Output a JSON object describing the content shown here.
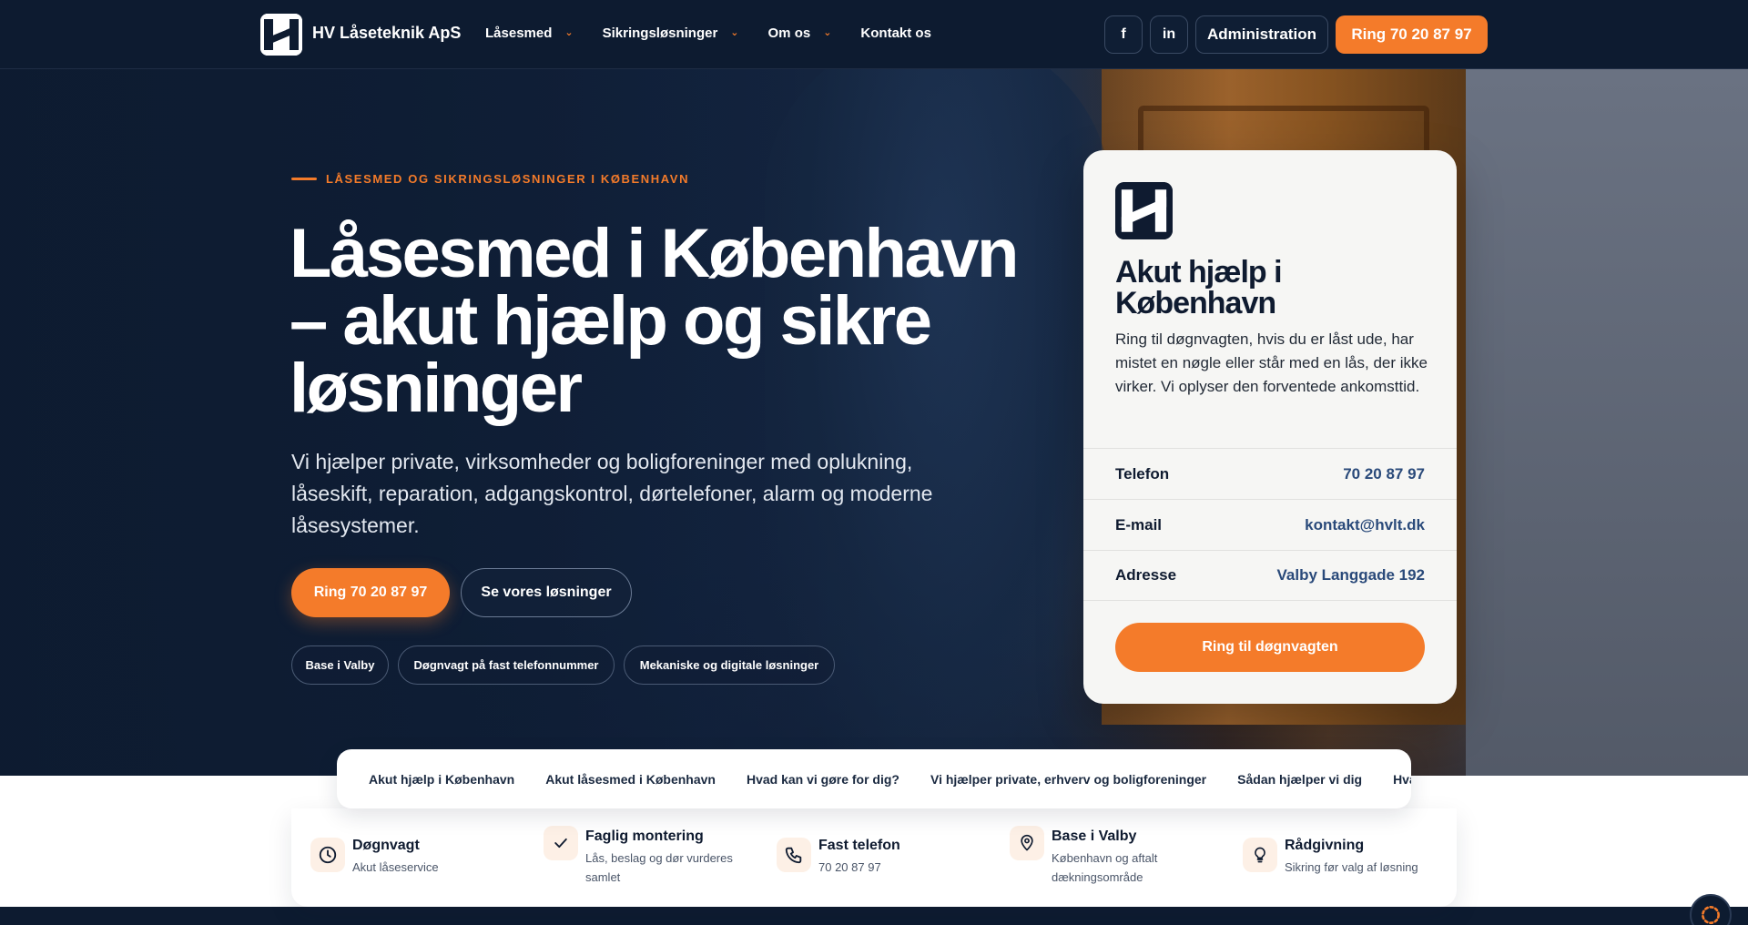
{
  "header": {
    "brand": "HV Låseteknik ApS",
    "nav": [
      {
        "label": "Låsesmed",
        "dropdown": true
      },
      {
        "label": "Sikringsløsninger",
        "dropdown": true
      },
      {
        "label": "Om os",
        "dropdown": true
      },
      {
        "label": "Kontakt os",
        "dropdown": false
      }
    ],
    "social_facebook": "f",
    "social_linkedin": "in",
    "admin_label": "Administration",
    "call_label": "Ring 70 20 87 97"
  },
  "hero": {
    "eyebrow": "LÅSESMED OG SIKRINGSLØSNINGER I KØBENHAVN",
    "title": "Låsesmed i København – akut hjælp og sikre løsninger",
    "subtitle": "Vi hjælper private, virksomheder og boligforeninger med oplukning, låseskift, reparation, adgangskontrol, dørtelefoner, alarm og moderne låsesystemer.",
    "cta_primary": "Ring 70 20 87 97",
    "cta_secondary": "Se vores løsninger",
    "pills": [
      "Base i Valby",
      "Døgnvagt på fast telefonnummer",
      "Mekaniske og digitale løsninger"
    ]
  },
  "card": {
    "title": "Akut hjælp i København",
    "text": "Ring til døgnvagten, hvis du er låst ude, har mistet en nøgle eller står med en lås, der ikke virker. Vi oplyser den forventede ankomsttid.",
    "rows": [
      {
        "label": "Telefon",
        "value": "70 20 87 97"
      },
      {
        "label": "E-mail",
        "value": "kontakt@hvlt.dk"
      },
      {
        "label": "Adresse",
        "value": "Valby Langgade 192"
      }
    ],
    "button": "Ring til døgnvagten"
  },
  "tabs": [
    "Akut hjælp i København",
    "Akut låsesmed i København",
    "Hvad kan vi gøre for dig?",
    "Vi hjælper private, erhverv og boligforeninger",
    "Sådan hjælper vi dig",
    "Hvad siger kunderne"
  ],
  "features": [
    {
      "title": "Døgnvagt",
      "desc": "Akut låseservice",
      "icon": "clock-icon"
    },
    {
      "title": "Faglig montering",
      "desc": "Lås, beslag og dør vurderes samlet",
      "icon": "check-icon"
    },
    {
      "title": "Fast telefon",
      "desc": "70 20 87 97",
      "icon": "phone-icon"
    },
    {
      "title": "Base i Valby",
      "desc": "København og aftalt dækningsområde",
      "icon": "map-pin-icon"
    },
    {
      "title": "Rådgivning",
      "desc": "Sikring før valg af løsning",
      "icon": "lightbulb-icon"
    }
  ],
  "colors": {
    "accent": "#f47b2a",
    "navy": "#0d1b30",
    "link": "#2a4a7a"
  }
}
